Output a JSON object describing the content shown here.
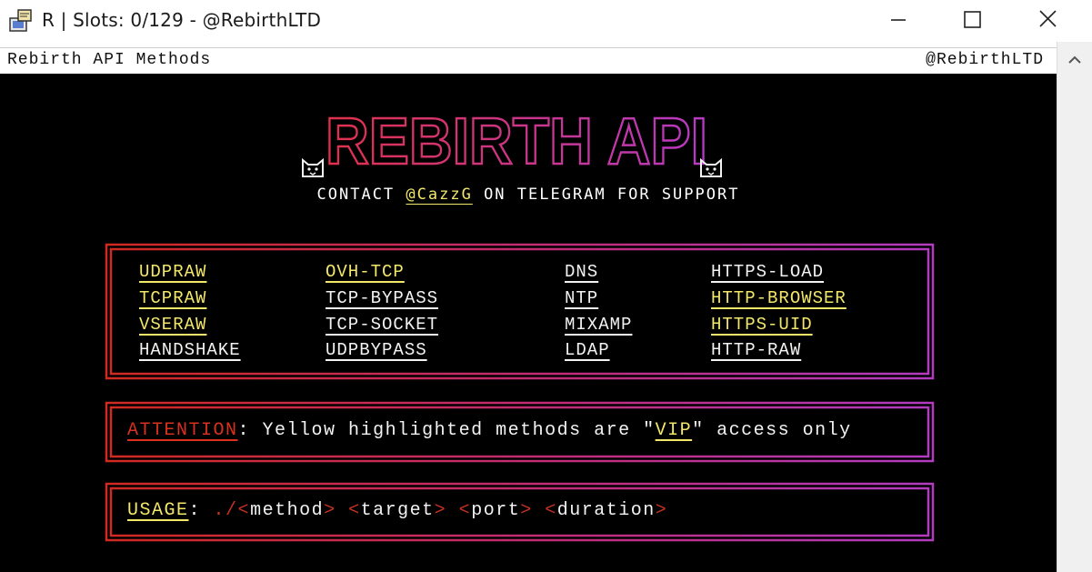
{
  "window": {
    "title": "R | Slots: 0/129 - @RebirthLTD",
    "controls": {
      "minimize": "minimize-icon",
      "maximize": "maximize-icon",
      "close": "close-icon"
    }
  },
  "console": {
    "title": "Rebirth API Methods",
    "handle": "@RebirthLTD"
  },
  "banner": {
    "logo_text": "REBIRTH API",
    "contact_prefix": "CONTACT ",
    "contact_handle": "@CazzG",
    "contact_suffix": " ON TELEGRAM FOR SUPPORT"
  },
  "methods": {
    "columns": [
      [
        {
          "name": "UDPRAW",
          "vip": true
        },
        {
          "name": "TCPRAW",
          "vip": true
        },
        {
          "name": "VSERAW",
          "vip": true
        },
        {
          "name": "HANDSHAKE",
          "vip": false
        }
      ],
      [
        {
          "name": "OVH-TCP",
          "vip": true
        },
        {
          "name": "TCP-BYPASS",
          "vip": false
        },
        {
          "name": "TCP-SOCKET",
          "vip": false
        },
        {
          "name": "UDPBYPASS",
          "vip": false
        }
      ],
      [
        {
          "name": "DNS",
          "vip": false
        },
        {
          "name": "NTP",
          "vip": false
        },
        {
          "name": "MIXAMP",
          "vip": false
        },
        {
          "name": "LDAP",
          "vip": false
        }
      ],
      [
        {
          "name": "HTTPS-LOAD",
          "vip": false
        },
        {
          "name": "HTTP-BROWSER",
          "vip": true
        },
        {
          "name": "HTTPS-UID",
          "vip": true
        },
        {
          "name": "HTTP-RAW",
          "vip": false
        }
      ]
    ]
  },
  "attention": {
    "label": "ATTENTION",
    "colon": ": ",
    "text_before": "Yellow highlighted methods are \"",
    "vip": "VIP",
    "text_after": "\" access only"
  },
  "usage": {
    "label": "USAGE",
    "colon": ": ",
    "prefix": "./",
    "lt": "<",
    "gt": ">",
    "args": [
      "method",
      "target",
      "port",
      "duration"
    ]
  },
  "colors": {
    "vip": "#f3e76a",
    "frame_start": "#d02a22",
    "frame_end": "#b23bc0",
    "attention": "#d8311e"
  }
}
